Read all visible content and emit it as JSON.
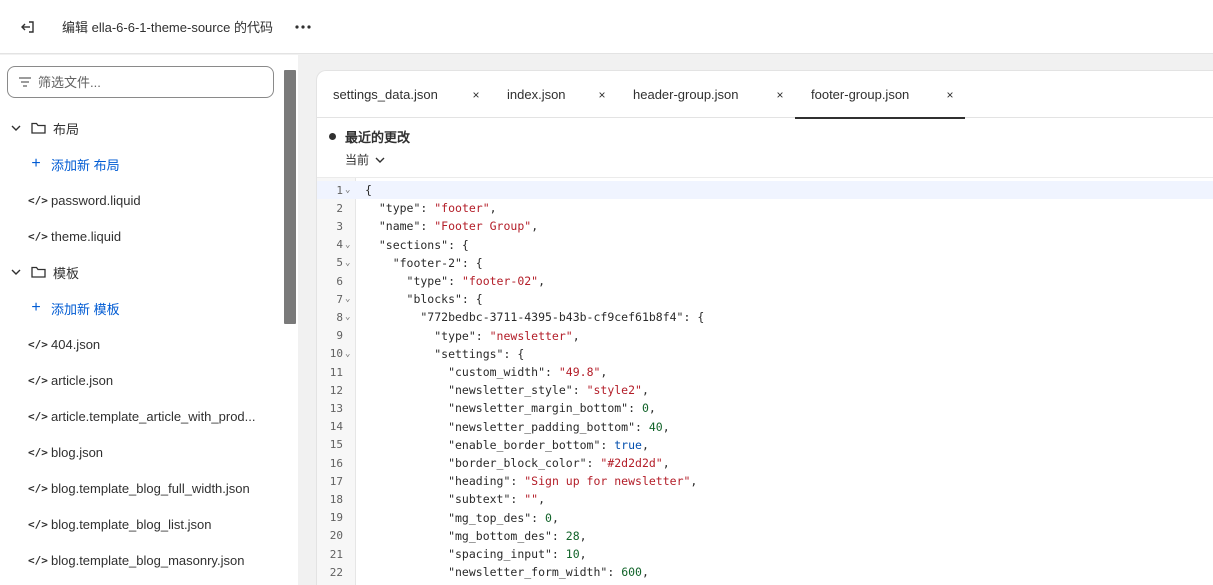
{
  "topbar": {
    "title": "编辑 ella-6-6-1-theme-source 的代码"
  },
  "sidebar": {
    "filter_placeholder": "筛选文件...",
    "rows": [
      {
        "kind": "folder",
        "label": "布局"
      },
      {
        "kind": "add",
        "label": "添加新 布局"
      },
      {
        "kind": "file",
        "label": "password.liquid"
      },
      {
        "kind": "file",
        "label": "theme.liquid"
      },
      {
        "kind": "folder",
        "label": "模板"
      },
      {
        "kind": "add",
        "label": "添加新 模板"
      },
      {
        "kind": "file",
        "label": "404.json"
      },
      {
        "kind": "file",
        "label": "article.json"
      },
      {
        "kind": "file",
        "label": "article.template_article_with_prod..."
      },
      {
        "kind": "file",
        "label": "blog.json"
      },
      {
        "kind": "file",
        "label": "blog.template_blog_full_width.json"
      },
      {
        "kind": "file",
        "label": "blog.template_blog_list.json"
      },
      {
        "kind": "file",
        "label": "blog.template_blog_masonry.json"
      }
    ]
  },
  "editor": {
    "tabs": [
      {
        "label": "settings_data.json",
        "active": false
      },
      {
        "label": "index.json",
        "active": false
      },
      {
        "label": "header-group.json",
        "active": false
      },
      {
        "label": "footer-group.json",
        "active": true
      }
    ],
    "changes_title": "最近的更改",
    "version_label": "当前",
    "code_lines": [
      {
        "n": "1",
        "fold": true,
        "text": "{"
      },
      {
        "n": "2",
        "fold": false,
        "text": "  \"type\": \"footer\","
      },
      {
        "n": "3",
        "fold": false,
        "text": "  \"name\": \"Footer Group\","
      },
      {
        "n": "4",
        "fold": true,
        "text": "  \"sections\": {"
      },
      {
        "n": "5",
        "fold": true,
        "text": "    \"footer-2\": {"
      },
      {
        "n": "6",
        "fold": false,
        "text": "      \"type\": \"footer-02\","
      },
      {
        "n": "7",
        "fold": true,
        "text": "      \"blocks\": {"
      },
      {
        "n": "8",
        "fold": true,
        "text": "        \"772bedbc-3711-4395-b43b-cf9cef61b8f4\": {"
      },
      {
        "n": "9",
        "fold": false,
        "text": "          \"type\": \"newsletter\","
      },
      {
        "n": "10",
        "fold": true,
        "text": "          \"settings\": {"
      },
      {
        "n": "11",
        "fold": false,
        "text": "            \"custom_width\": \"49.8\","
      },
      {
        "n": "12",
        "fold": false,
        "text": "            \"newsletter_style\": \"style2\","
      },
      {
        "n": "13",
        "fold": false,
        "text": "            \"newsletter_margin_bottom\": 0,"
      },
      {
        "n": "14",
        "fold": false,
        "text": "            \"newsletter_padding_bottom\": 40,"
      },
      {
        "n": "15",
        "fold": false,
        "text": "            \"enable_border_bottom\": true,"
      },
      {
        "n": "16",
        "fold": false,
        "text": "            \"border_block_color\": \"#2d2d2d\","
      },
      {
        "n": "17",
        "fold": false,
        "text": "            \"heading\": \"Sign up for newsletter\","
      },
      {
        "n": "18",
        "fold": false,
        "text": "            \"subtext\": \"\","
      },
      {
        "n": "19",
        "fold": false,
        "text": "            \"mg_top_des\": 0,"
      },
      {
        "n": "20",
        "fold": false,
        "text": "            \"mg_bottom_des\": 28,"
      },
      {
        "n": "21",
        "fold": false,
        "text": "            \"spacing_input\": 10,"
      },
      {
        "n": "22",
        "fold": false,
        "text": "            \"newsletter_form_width\": 600,"
      }
    ]
  },
  "colors": {
    "link": "#005bd3",
    "string": "#b31d28",
    "number": "#116329",
    "keyword": "#0550ae"
  }
}
